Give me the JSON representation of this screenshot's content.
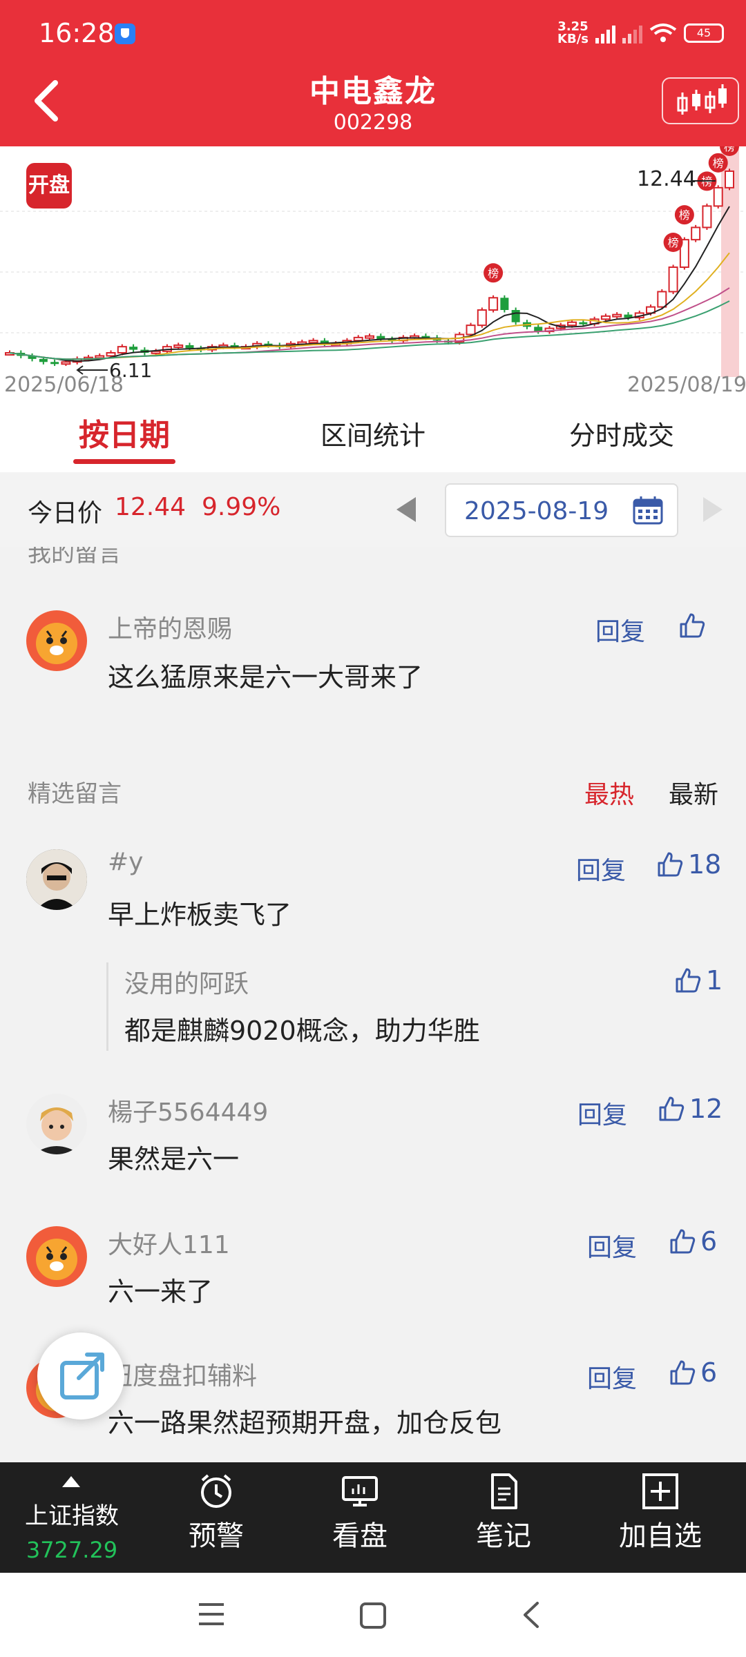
{
  "status_bar": {
    "time": "16:28",
    "speed_value": "3.25",
    "speed_unit": "KB/s",
    "battery": "45"
  },
  "header": {
    "title": "中电鑫龙",
    "code": "002298"
  },
  "chart": {
    "badge": "开盘",
    "start_date": "2025/06/18",
    "end_date": "2025/08/19",
    "high_label": "12.44",
    "low_label": "6.11",
    "rank_tag": "榜"
  },
  "chart_data": {
    "type": "candlestick",
    "x_start": "2025/06/18",
    "x_end": "2025/08/19",
    "close": [
      6.5,
      6.4,
      6.3,
      6.2,
      6.15,
      6.2,
      6.3,
      6.35,
      6.4,
      6.5,
      6.7,
      6.6,
      6.5,
      6.55,
      6.7,
      6.75,
      6.65,
      6.6,
      6.7,
      6.75,
      6.7,
      6.7,
      6.8,
      6.75,
      6.7,
      6.8,
      6.85,
      6.9,
      6.8,
      6.8,
      6.9,
      7.0,
      7.05,
      6.95,
      6.9,
      7.0,
      7.05,
      7.0,
      6.9,
      6.85,
      7.1,
      7.4,
      7.9,
      8.3,
      7.9,
      7.5,
      7.35,
      7.2,
      7.3,
      7.4,
      7.5,
      7.45,
      7.6,
      7.7,
      7.75,
      7.65,
      7.8,
      8.0,
      8.5,
      9.3,
      10.2,
      10.6,
      11.3,
      11.9,
      12.44
    ],
    "annotations": {
      "high": "12.44",
      "low": "6.11"
    }
  },
  "tabs": [
    "按日期",
    "区间统计",
    "分时成交"
  ],
  "price_bar": {
    "label": "今日价",
    "price": "12.44",
    "change": "9.99%",
    "date": "2025-08-19"
  },
  "my_comments": {
    "title": "我的留言",
    "items": [
      {
        "user": "上帝的恩赐",
        "text": "这么猛原来是六一大哥来了",
        "reply": "回复"
      }
    ]
  },
  "featured": {
    "title": "精选留言",
    "sort_hot": "最热",
    "sort_new": "最新",
    "items": [
      {
        "user": "#y",
        "text": "早上炸板卖飞了",
        "reply": "回复",
        "likes": "18"
      },
      {
        "user": "楊子5564449",
        "text": "果然是六一",
        "reply": "回复",
        "likes": "12"
      },
      {
        "user": "大好人111",
        "text": "六一来了",
        "reply": "回复",
        "likes": "6"
      },
      {
        "user": "纽度盘扣辅料",
        "text": "六一路果然超预期开盘，加仓反包",
        "reply": "回复",
        "likes": "6"
      }
    ],
    "nested_reply": {
      "user": "没用的阿跃",
      "text": "都是麒麟9020概念，助力华胜",
      "likes": "1"
    }
  },
  "bottom_nav": {
    "index_name": "上证指数",
    "index_value": "3727.29",
    "items": [
      "预警",
      "看盘",
      "笔记",
      "加自选"
    ]
  },
  "colors": {
    "brand": "#e8303a",
    "up": "#d7252c",
    "down": "#1e9e3c",
    "link": "#3a5aa8",
    "index_up": "#22c25a"
  }
}
